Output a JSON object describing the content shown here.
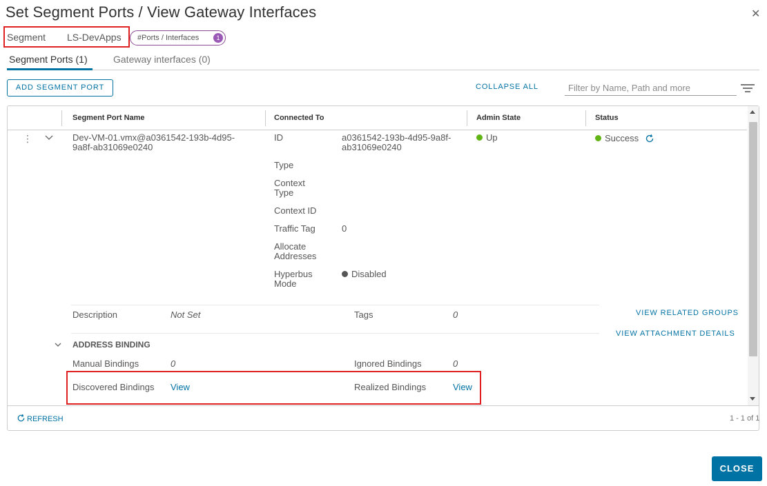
{
  "dialog": {
    "title": "Set Segment Ports / View Gateway Interfaces",
    "close_icon": "close-icon"
  },
  "segment": {
    "label": "Segment",
    "value": "LS-DevApps",
    "badge_label": "#Ports / Interfaces",
    "badge_count": "1"
  },
  "tabs": [
    {
      "label": "Segment Ports (1)",
      "active": true
    },
    {
      "label": "Gateway interfaces (0)",
      "active": false
    }
  ],
  "toolbar": {
    "add_label": "ADD SEGMENT PORT",
    "collapse_label": "COLLAPSE ALL",
    "filter_placeholder": "Filter by Name, Path and more",
    "filter_icon": "filter-icon"
  },
  "grid": {
    "columns": [
      "Segment Port Name",
      "Connected To",
      "Admin State",
      "Status"
    ],
    "row": {
      "name_line1": "Dev-VM-01.vmx@a0361542-193b-4d95-",
      "name_line2": "9a8f-ab31069e0240",
      "connected": [
        {
          "key": "ID",
          "value": "a0361542-193b-4d95-9a8f-ab31069e0240"
        },
        {
          "key": "Type",
          "value": ""
        },
        {
          "key": "Context Type",
          "value": ""
        },
        {
          "key": "Context ID",
          "value": ""
        },
        {
          "key": "Traffic Tag",
          "value": "0"
        },
        {
          "key": "Allocate Addresses",
          "value": ""
        },
        {
          "key": "Hyperbus Mode",
          "value": "Disabled"
        }
      ],
      "id_value_line1": "a0361542-193b-4d95-9a8f-",
      "id_value_line2": "ab31069e0240",
      "admin_state": "Up",
      "status": "Success",
      "description_label": "Description",
      "description_value": "Not Set",
      "tags_label": "Tags",
      "tags_value": "0",
      "view_related_groups": "VIEW RELATED GROUPS",
      "view_attachment_details": "VIEW ATTACHMENT DETAILS",
      "address_binding_title": "ADDRESS BINDING",
      "manual_bindings_label": "Manual Bindings",
      "manual_bindings_value": "0",
      "ignored_bindings_label": "Ignored Bindings",
      "ignored_bindings_value": "0",
      "discovered_bindings_label": "Discovered Bindings",
      "discovered_bindings_link": "View",
      "realized_bindings_label": "Realized Bindings",
      "realized_bindings_link": "View"
    },
    "footer": {
      "refresh_label": "REFRESH",
      "pager": "1 - 1 of 1"
    }
  },
  "actions": {
    "close_label": "CLOSE"
  },
  "colors": {
    "accent": "#0072a3",
    "success": "#60b515",
    "disabled": "#565656",
    "highlight_box": "#e02020",
    "badge": "#9b59b6"
  }
}
